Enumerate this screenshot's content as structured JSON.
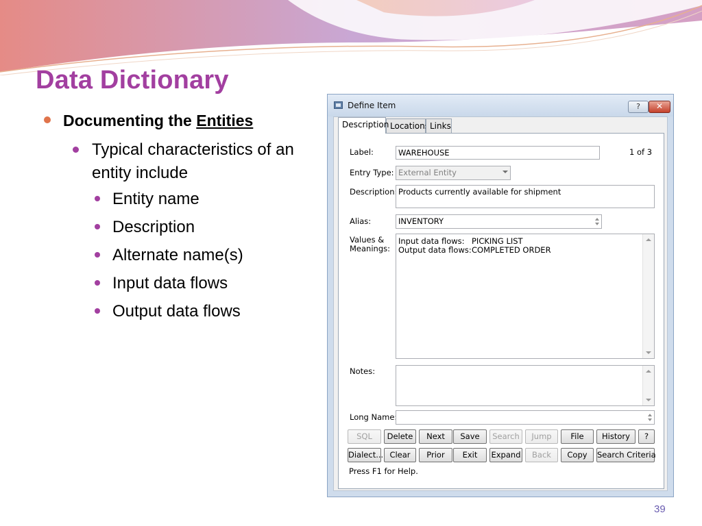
{
  "slide": {
    "title": "Data Dictionary",
    "bullet1_prefix": "Documenting the ",
    "bullet1_emph": "Entities",
    "bullet2": "Typical characteristics of an entity include",
    "sub_bullets": [
      "Entity name",
      "Description",
      "Alternate name(s)",
      "Input data flows",
      "Output data flows"
    ],
    "page_number": "39"
  },
  "dialog": {
    "title": "Define Item",
    "help_glyph": "?",
    "close_glyph": "✕",
    "tabs": [
      "Description",
      "Locations",
      "Links"
    ],
    "label_caption": "Label:",
    "label_value": "WAREHOUSE",
    "record_position": "1 of 3",
    "entry_type_caption": "Entry Type:",
    "entry_type_value": "External Entity",
    "description_caption": "Description:",
    "description_value": "Products currently available for shipment",
    "alias_caption": "Alias:",
    "alias_value": "INVENTORY",
    "values_caption": "Values & Meanings:",
    "values_lines": [
      {
        "key": "Input data flows:",
        "value": "PICKING LIST"
      },
      {
        "key": "Output data flows:",
        "value": "COMPLETED ORDER"
      }
    ],
    "notes_caption": "Notes:",
    "long_name_caption": "Long Name:",
    "buttons_row1": [
      "SQL",
      "Delete",
      "Next",
      "Save",
      "Search",
      "Jump",
      "File",
      "History",
      "?"
    ],
    "buttons_row2": [
      "Dialect...",
      "Clear",
      "Prior",
      "Exit",
      "Expand",
      "Back",
      "Copy",
      "Search Criteria"
    ],
    "status_text": "Press F1 for Help."
  },
  "colors": {
    "title": "#a23fa0",
    "bullet_orange": "#e0744b",
    "bullet_purple": "#a23fa0",
    "page_number": "#6a5cb0"
  }
}
